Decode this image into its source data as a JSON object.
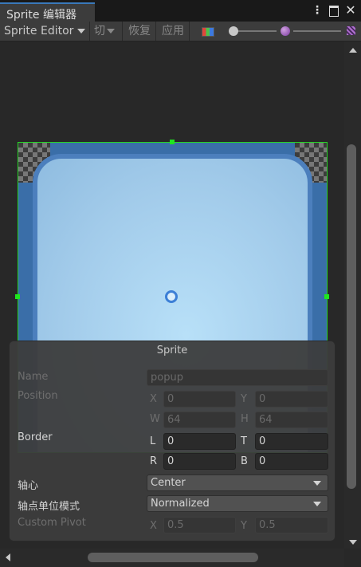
{
  "window": {
    "tab_title": "Sprite 编辑器"
  },
  "toolbar": {
    "mode": "Sprite Editor",
    "slice": "切",
    "revert": "恢复",
    "apply": "应用",
    "color_channel_icon": "rgb-channel-icon",
    "zoom_icon": "circle-slider-icon",
    "mip_small_icon": "mip-small-icon",
    "mip_large_icon": "mip-large-icon"
  },
  "canvas": {
    "sprite_border_color": "#27d327",
    "pivot_color": "#3c7fd6"
  },
  "panel": {
    "title": "Sprite",
    "name_label": "Name",
    "name_value": "popup",
    "position_label": "Position",
    "position": {
      "x_label": "X",
      "x": "0",
      "y_label": "Y",
      "y": "0",
      "w_label": "W",
      "w": "64",
      "h_label": "H",
      "h": "64"
    },
    "border_label": "Border",
    "border": {
      "l_label": "L",
      "l": "0",
      "t_label": "T",
      "t": "0",
      "r_label": "R",
      "r": "0",
      "b_label": "B",
      "b": "0"
    },
    "pivot_label": "轴心",
    "pivot_value": "Center",
    "pivot_unit_label": "轴点单位模式",
    "pivot_unit_value": "Normalized",
    "custom_pivot_label": "Custom Pivot",
    "custom_pivot": {
      "x_label": "X",
      "x": "0.5",
      "y_label": "Y",
      "y": "0.5"
    }
  }
}
